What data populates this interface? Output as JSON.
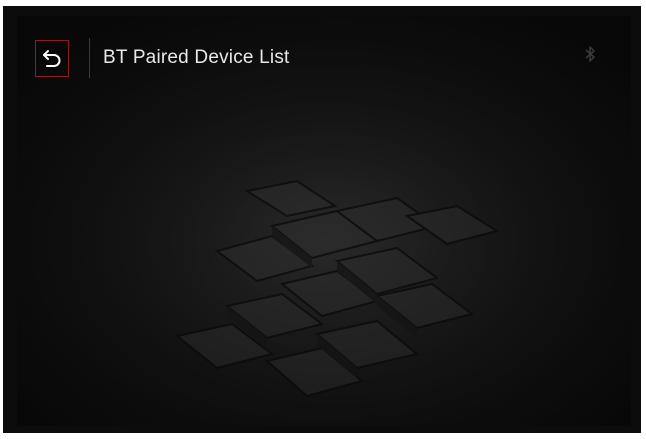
{
  "window": {
    "title": "BT Paired Device List"
  },
  "header": {
    "back_icon": "back-arrow-icon",
    "status_icon": "bluetooth-icon"
  },
  "colors": {
    "background": "#151515",
    "focus_border": "#d0363f",
    "title_text": "#e8e8e8"
  },
  "device_list": []
}
